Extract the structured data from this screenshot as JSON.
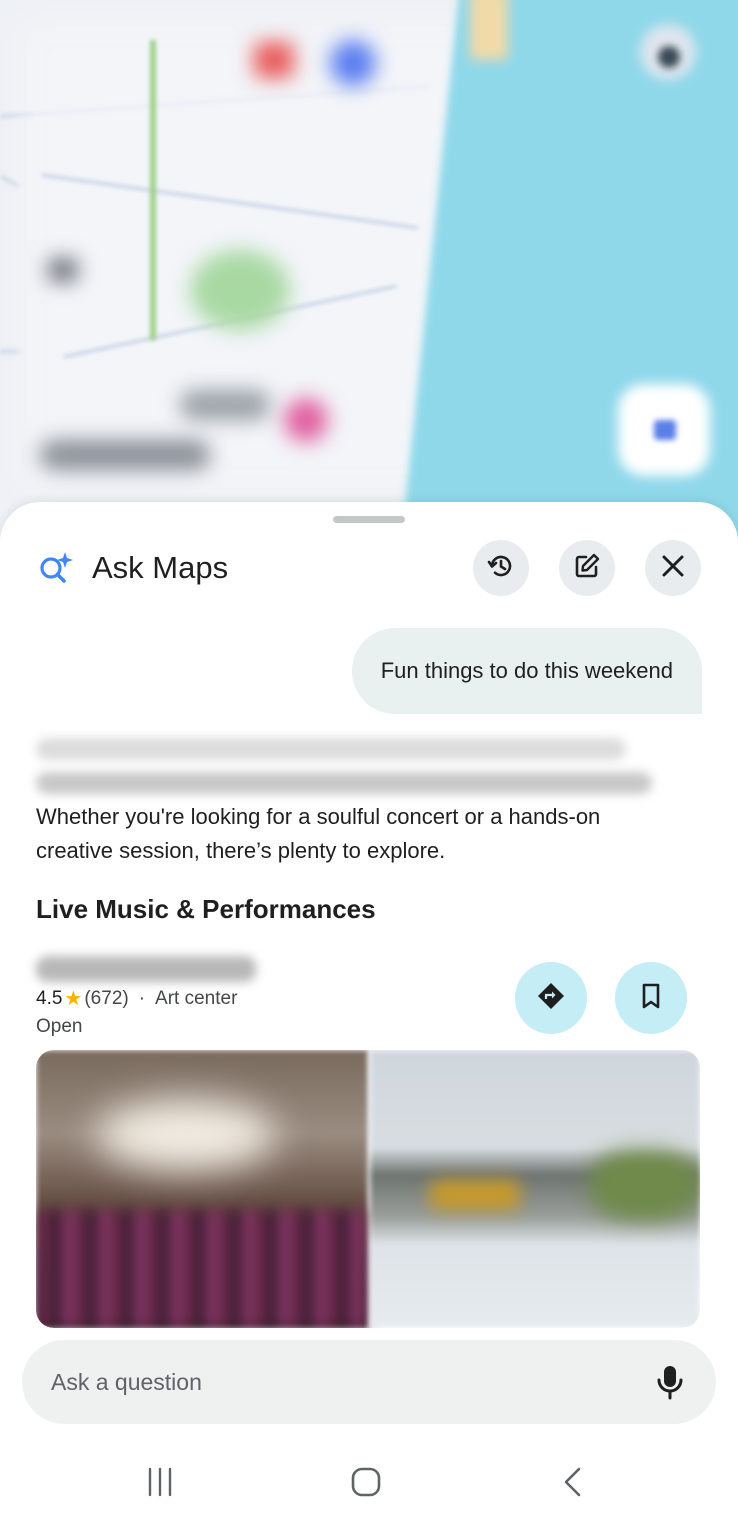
{
  "header": {
    "title": "Ask Maps",
    "logo_icon": "sparkle-search-icon",
    "actions": [
      {
        "name": "history-button",
        "icon": "history-icon"
      },
      {
        "name": "new-chat-button",
        "icon": "edit-icon"
      },
      {
        "name": "close-button",
        "icon": "close-icon"
      }
    ]
  },
  "chat": {
    "user_message": "Fun things to do this weekend",
    "answer_text": "Whether you're looking for a soulful concert or a hands-on creative session, there’s plenty to explore."
  },
  "section": {
    "title": "Live Music & Performances"
  },
  "place": {
    "rating": "4.5",
    "star_icon": "star-icon",
    "review_count": "(672)",
    "separator": "·",
    "category": "Art center",
    "status": "Open",
    "actions": [
      {
        "name": "directions-button",
        "icon": "directions-icon"
      },
      {
        "name": "save-button",
        "icon": "bookmark-icon"
      }
    ]
  },
  "input": {
    "placeholder": "Ask a question",
    "mic_icon": "mic-icon"
  },
  "system_nav": {
    "recents_icon": "recents-icon",
    "home_icon": "home-icon",
    "back_icon": "back-icon"
  },
  "colors": {
    "sea": "#8fd8ea",
    "bubble": "#e8f1ef",
    "action_button": "#c5edf6",
    "icon_button": "#e9ecee",
    "accent_blue": "#4285f4",
    "star": "#f4b400"
  }
}
